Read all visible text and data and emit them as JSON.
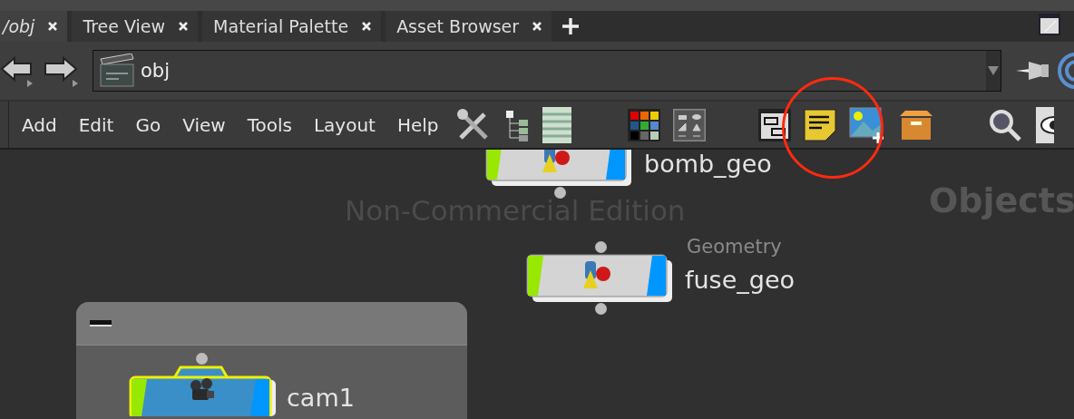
{
  "tabs": [
    {
      "label": "/obj",
      "selected": true
    },
    {
      "label": "Tree View",
      "selected": false
    },
    {
      "label": "Material Palette",
      "selected": false
    },
    {
      "label": "Asset Browser",
      "selected": false
    }
  ],
  "path_bar": {
    "path": "obj"
  },
  "menu": [
    "Add",
    "Edit",
    "Go",
    "View",
    "Tools",
    "Layout",
    "Help"
  ],
  "network": {
    "watermark": "Non-Commercial Edition",
    "context_label": "Objects",
    "nodes": [
      {
        "name": "bomb_geo",
        "kind": "geometry",
        "selected": false
      },
      {
        "name": "fuse_geo",
        "kind": "geometry",
        "type_label": "Geometry",
        "selected": false
      }
    ],
    "network_box": {
      "nodes": [
        {
          "name": "cam1",
          "kind": "camera",
          "selected": true
        }
      ]
    }
  }
}
